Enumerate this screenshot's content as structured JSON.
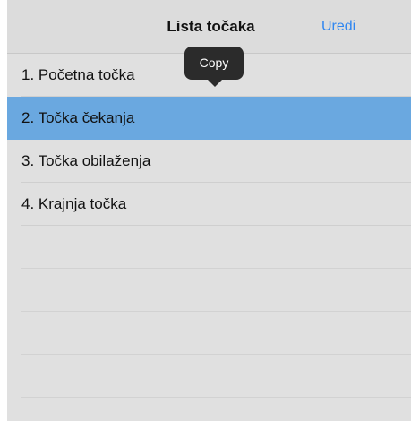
{
  "navbar": {
    "title": "Lista točaka",
    "edit_label": "Uredi"
  },
  "tooltip": {
    "label": "Copy"
  },
  "list": {
    "items": [
      {
        "label": "1. Početna točka"
      },
      {
        "label": "2. Točka čekanja",
        "selected": true
      },
      {
        "label": "3. Točka obilaženja"
      },
      {
        "label": "4. Krajnja točka"
      }
    ]
  },
  "colors": {
    "accent": "#2f86f0",
    "selection": "#6aa8e0",
    "background": "#e0e0e0"
  }
}
